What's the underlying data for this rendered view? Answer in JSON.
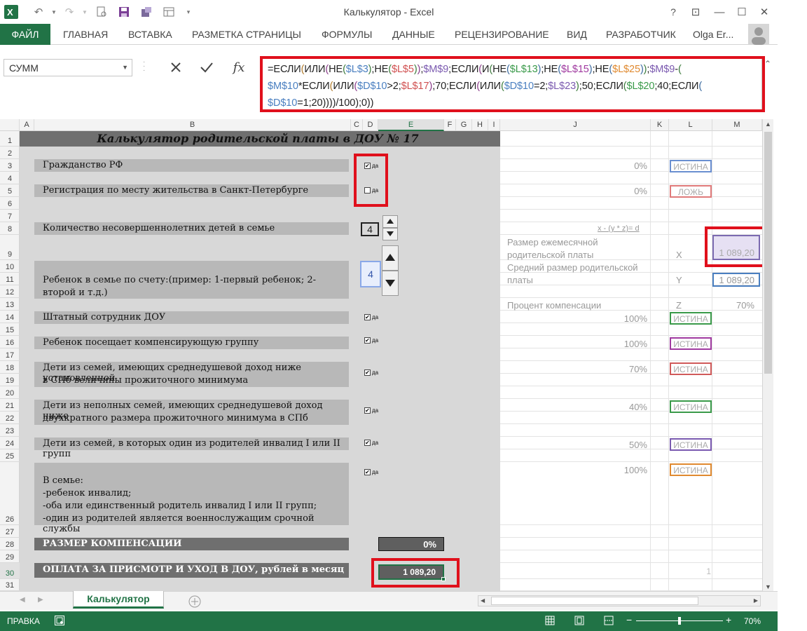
{
  "window": {
    "title": "Калькулятор - Excel",
    "help": "?",
    "restore_ribbon": "⊡",
    "minimize": "—",
    "maximize": "☐",
    "close": "✕"
  },
  "quick_access": [
    "excel-logo-icon",
    "undo-icon",
    "redo-icon",
    "print-preview-icon",
    "save-icon",
    "save-as-icon",
    "form-icon",
    "customize-icon"
  ],
  "ribbon": {
    "file": "ФАЙЛ",
    "tabs": [
      "ГЛАВНАЯ",
      "ВСТАВКА",
      "РАЗМЕТКА СТРАНИЦЫ",
      "ФОРМУЛЫ",
      "ДАННЫЕ",
      "РЕЦЕНЗИРОВАНИЕ",
      "ВИД",
      "РАЗРАБОТЧИК"
    ],
    "user": "Olga Er..."
  },
  "formula_bar": {
    "name_box": "СУММ",
    "cancel": "✕",
    "enter": "✓",
    "fx": "fx",
    "formula_line1": "=ЕСЛИ(ИЛИ(НЕ($L$3);НЕ($L$5));$M$9;ЕСЛИ(И(НЕ($L$13);НЕ($L$15);НЕ($L$25));$M$9-(",
    "formula_line2": "$M$10*ЕСЛИ(ИЛИ($D$10>2;$L$17);70;ЕСЛИ(ИЛИ($D$10=2;$L$23);50;ЕСЛИ($L$20;40;ЕСЛИ(",
    "formula_line3": "$D$10=1;20))))/100);0))"
  },
  "columns": [
    "A",
    "B",
    "C",
    "D",
    "E",
    "F",
    "G",
    "H",
    "I",
    "J",
    "K",
    "L",
    "M"
  ],
  "rows": [
    "1",
    "2",
    "3",
    "4",
    "5",
    "6",
    "7",
    "8",
    "9",
    "10",
    "11",
    "12",
    "13",
    "14",
    "15",
    "16",
    "17",
    "18",
    "19",
    "20",
    "21",
    "22",
    "23",
    "24",
    "25",
    "26",
    "27",
    "28",
    "29",
    "30",
    "31"
  ],
  "sheet": {
    "title": "Калькулятор родительской платы в ДОУ № 17",
    "citizenship": "Гражданство РФ",
    "registration": "Регистрация по месту жительства в Санкт-Петербурге",
    "children_count_label": "Количество несовершеннолетних детей в семье",
    "children_count": "4",
    "child_order_label": "Ребенок в семье по счету:(пример: 1-первый ребенок; 2- второй и т.д.)",
    "child_order": "4",
    "staff": "Штатный сотрудник ДОУ",
    "compensating_group": "Ребенок посещает компенсирующую группу",
    "low_income_1": "Дети из семей, имеющих среднедушевой доход ниже установленной",
    "low_income_2": "в СПб величины прожиточного минимума",
    "incomplete_1": "Дети из неполных семей, имеющих среднедушевой доход ниже",
    "incomplete_2": "двухкратного размера прожиточного минимума в СПб",
    "disabled_parent": "Дети из семей, в которых один из родителей инвалид I или II групп",
    "family_1": "В семье:",
    "family_2": "-ребенок инвалид;",
    "family_3": "-оба или единственный родитель инвалид I или II групп;",
    "family_4": "-один из родителей является военнослужащим срочной службы",
    "compensation_label": "РАЗМЕР КОМПЕНСАЦИИ",
    "compensation_value": "0%",
    "payment_label": "ОПЛАТА ЗА ПРИСМОТР И УХОД В ДОУ, рублей в месяц",
    "payment_value": "1 089,20",
    "checkbox_label": "да"
  },
  "checkboxes": {
    "row3": true,
    "row5": false,
    "row13": true,
    "row15": true,
    "row17": true,
    "row20": true,
    "row23": true,
    "row25": true
  },
  "right_panel": {
    "p3": "0%",
    "l3": "ИСТИНА",
    "p5": "0%",
    "l5": "ЛОЖЬ",
    "formula_note": "x - (y * z)= d",
    "size_label_1": "Размер ежемесячной",
    "size_label_2": "родительской платы",
    "x": "X",
    "m9": "1 089,20",
    "avg_label_1": "Средний размер родительской",
    "avg_label_2": "платы",
    "y": "Y",
    "m10": "1 089,20",
    "pct_label": "Процент компенсации",
    "z": "Z",
    "m12": "70%",
    "p13": "100%",
    "l13": "ИСТИНА",
    "p15": "100%",
    "l15": "ИСТИНА",
    "p17": "70%",
    "l17": "ИСТИНА",
    "p20": "40%",
    "l20": "ИСТИНА",
    "p23": "50%",
    "l23": "ИСТИНА",
    "p25": "100%",
    "l25": "ИСТИНА",
    "l30": "1"
  },
  "sheet_tabs": {
    "active": "Калькулятор"
  },
  "status": {
    "mode": "ПРАВКА",
    "zoom": "70%"
  },
  "colors": {
    "accent": "#217346",
    "highlight": "#e0101c"
  }
}
